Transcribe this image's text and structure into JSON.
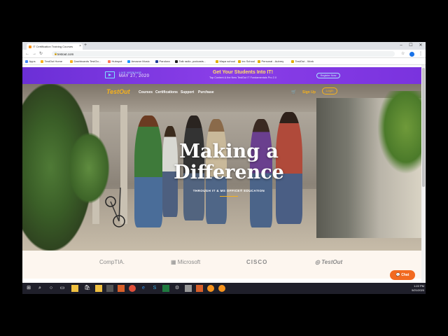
{
  "browser": {
    "tab_title": "IT Certification Training Courses",
    "tab_close": "×",
    "new_tab": "+",
    "url": "testout.com",
    "window_controls": [
      "–",
      "☐",
      "✕"
    ]
  },
  "bookmarks": [
    {
      "label": "Apps",
      "color": "#4285f4"
    },
    {
      "label": "TestOut Home",
      "color": "#f7b21b"
    },
    {
      "label": "Dashboards TestOu...",
      "color": "#f7b21b"
    },
    {
      "label": "Hubspot",
      "color": "#ff7a59"
    },
    {
      "label": "Amazon Music",
      "color": "#1a98ff"
    },
    {
      "label": "Pandora",
      "color": "#224099"
    },
    {
      "label": "Talk radio, podcasts...",
      "color": "#222222"
    },
    {
      "label": "Maya school",
      "color": "#e0b000"
    },
    {
      "label": "lex School",
      "color": "#e0b000"
    },
    {
      "label": "Personal - Aubrey",
      "color": "#e0b000"
    },
    {
      "label": "TestOut - Work",
      "color": "#e0b000"
    }
  ],
  "banner": {
    "label": "LIVE WEBINAR",
    "date": "MAY 27, 2020",
    "headline": "Get Your Students Into IT!",
    "subtext": "Top Content & the New TestOut IT Fundamentals Pro 2.0",
    "button": "Register Now"
  },
  "site": {
    "logo": "TestOut",
    "nav": [
      "Courses",
      "Certifications",
      "Support",
      "Purchase"
    ],
    "signup": "Sign Up",
    "login": "Login"
  },
  "hero": {
    "title_line1": "Making a",
    "title_line2": "Difference",
    "subtitle": "THROUGH IT & MS OFFICE® EDUCATION"
  },
  "partners": [
    "CompTIA.",
    "Microsoft",
    "CISCO",
    "TestOut"
  ],
  "chat_label": "Chat",
  "taskbar": {
    "time": "1:22 PM",
    "date": "5/21/2020"
  },
  "colors": {
    "accent": "#f7b21b",
    "banner": "#7a33de",
    "chat": "#f26a20"
  }
}
